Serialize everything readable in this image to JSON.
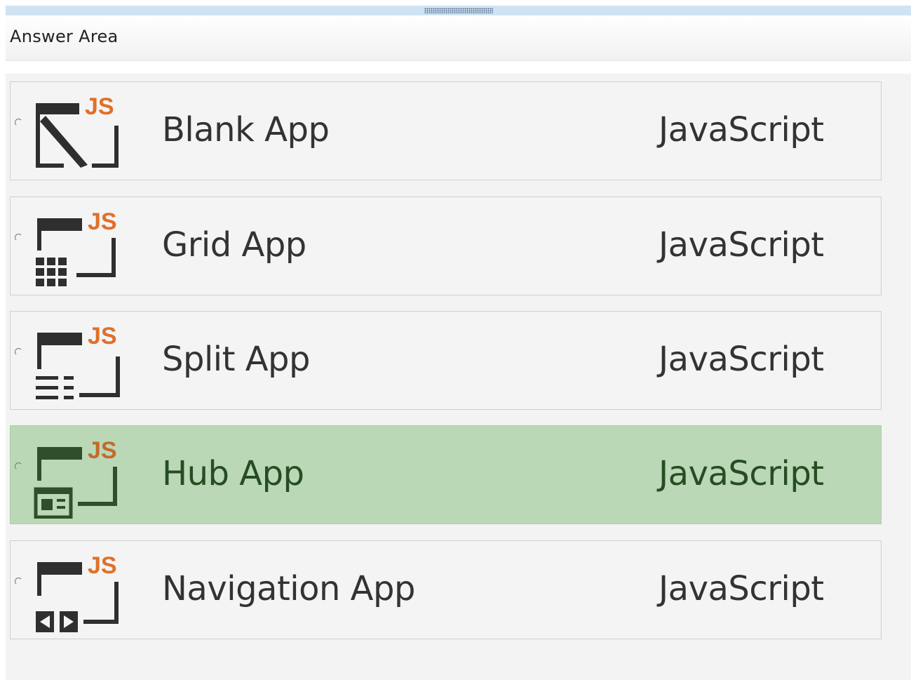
{
  "header": {
    "title": "Answer Area"
  },
  "options": [
    {
      "label": "Blank App",
      "language": "JavaScript",
      "badge": "JS",
      "icon": "blank-app-icon",
      "selected": false
    },
    {
      "label": "Grid App",
      "language": "JavaScript",
      "badge": "JS",
      "icon": "grid-app-icon",
      "selected": false
    },
    {
      "label": "Split App",
      "language": "JavaScript",
      "badge": "JS",
      "icon": "split-app-icon",
      "selected": false
    },
    {
      "label": "Hub App",
      "language": "JavaScript",
      "badge": "JS",
      "icon": "hub-app-icon",
      "selected": true
    },
    {
      "label": "Navigation App",
      "language": "JavaScript",
      "badge": "JS",
      "icon": "navigation-app-icon",
      "selected": false
    }
  ],
  "colors": {
    "selected_background": "#bad8b6",
    "badge": "#e0702a",
    "icon": "#2f2f2f",
    "selected_icon": "#2e4f2a"
  }
}
